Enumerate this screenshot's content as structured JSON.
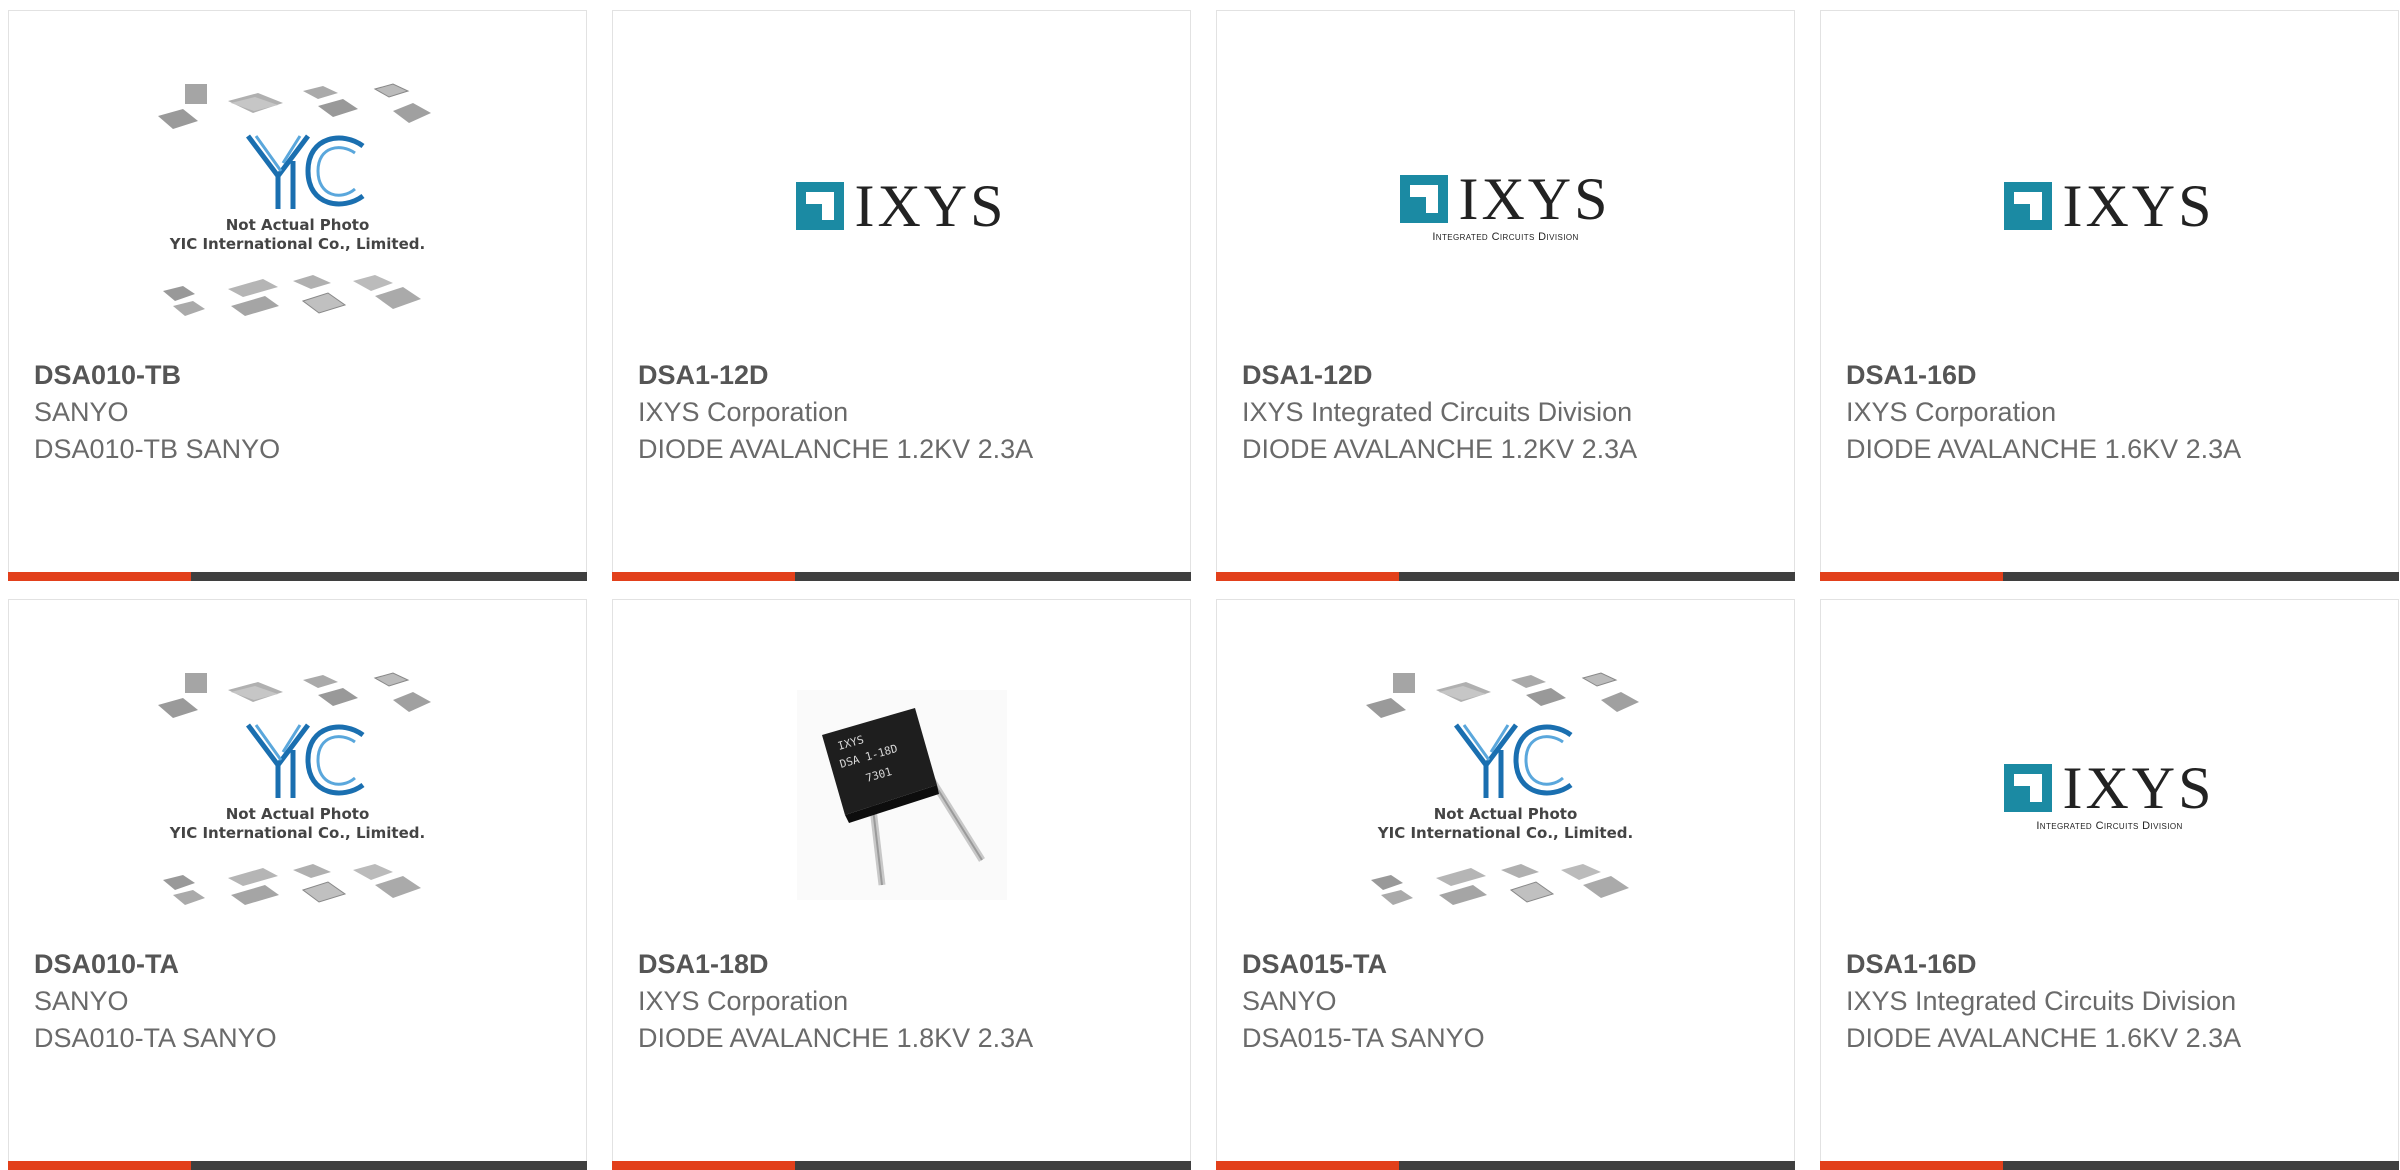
{
  "placeholder": {
    "line1": "Not Actual Photo",
    "line2": "YIC International Co., Limited."
  },
  "ixys": {
    "word": "IXYS",
    "division": "Integrated Circuits Division",
    "brand_color": "#1b8aa3"
  },
  "theme": {
    "accent": "#e2401b",
    "bar": "#3f3f3f"
  },
  "products": [
    {
      "part": "DSA010-TB",
      "maker": "SANYO",
      "desc": "DSA010-TB SANYO",
      "image": "yic-placeholder"
    },
    {
      "part": "DSA1-12D",
      "maker": "IXYS Corporation",
      "desc": "DIODE AVALANCHE 1.2KV 2.3A",
      "image": "ixys-logo"
    },
    {
      "part": "DSA1-12D",
      "maker": "IXYS Integrated Circuits Division",
      "desc": "DIODE AVALANCHE 1.2KV 2.3A",
      "image": "ixys-icd-logo"
    },
    {
      "part": "DSA1-16D",
      "maker": "IXYS Corporation",
      "desc": "DIODE AVALANCHE 1.6KV 2.3A",
      "image": "ixys-logo"
    },
    {
      "part": "DSA010-TA",
      "maker": "SANYO",
      "desc": "DSA010-TA SANYO",
      "image": "yic-placeholder"
    },
    {
      "part": "DSA1-18D",
      "maker": "IXYS Corporation",
      "desc": "DIODE AVALANCHE 1.8KV 2.3A",
      "image": "diode-photo"
    },
    {
      "part": "DSA015-TA",
      "maker": "SANYO",
      "desc": "DSA015-TA SANYO",
      "image": "yic-placeholder"
    },
    {
      "part": "DSA1-16D",
      "maker": "IXYS Integrated Circuits Division",
      "desc": "DIODE AVALANCHE 1.6KV 2.3A",
      "image": "ixys-icd-logo"
    }
  ]
}
